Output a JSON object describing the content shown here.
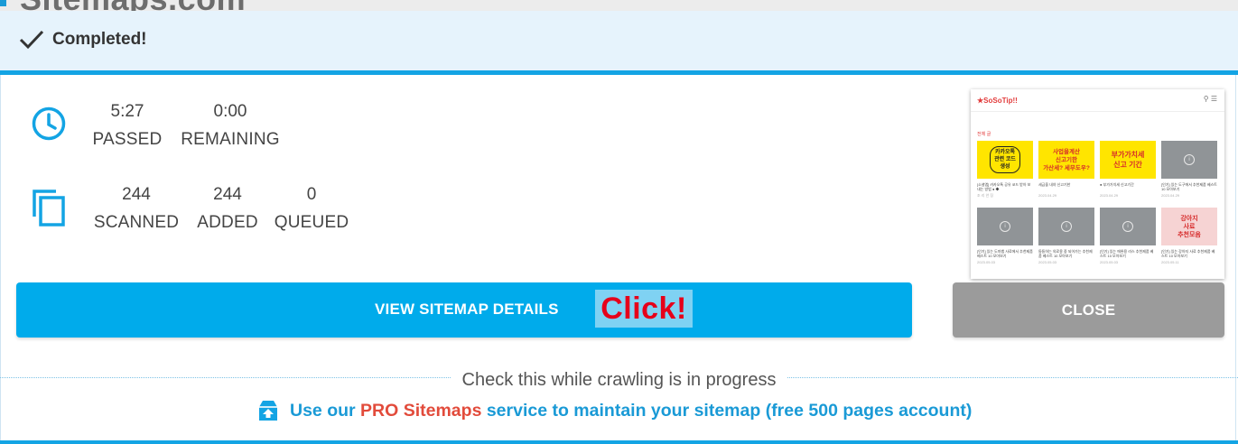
{
  "background_logo": "Sitemaps.com",
  "header": {
    "title": "Completed!",
    "icon": "checkmark-icon"
  },
  "time_stats": [
    {
      "value": "5:27",
      "label": "PASSED"
    },
    {
      "value": "0:00",
      "label": "REMAINING"
    }
  ],
  "page_stats": [
    {
      "value": "244",
      "label": "SCANNED"
    },
    {
      "value": "244",
      "label": "ADDED"
    },
    {
      "value": "0",
      "label": "QUEUED"
    }
  ],
  "icons": {
    "time": "clock-icon",
    "pages": "copy-pages-icon",
    "promo": "upload-cloud-icon"
  },
  "preview": {
    "site_name": "★SoSoTip!!",
    "section": "전체 글",
    "cards": [
      {
        "caption": "[소셜앱] 카카오톡 공유 코드 받아 보내는 방법 ● ◆",
        "date": "조 리 안 징",
        "img_text": "카카오톡\n관련 코드\n생성"
      },
      {
        "caption": "세금을 내야 신고기한",
        "date": "2023.04.29",
        "img_text": "사업을계산\n신고기한\n가산세? 세무도우?"
      },
      {
        "caption": "● 부가가치세 신고기간",
        "date": "2023.04.29",
        "img_text": "부가가치세\n신고 기간"
      },
      {
        "caption": "[인기] 있는 도구에서 추천제품 베스트 10 모아보기",
        "date": "2023.04.29",
        "img_text": ""
      },
      {
        "caption": "[인기] 있는 도마뱀 사료에서 추천제품 베스트 10 모아보기",
        "date": "2023.05.03",
        "img_text": ""
      },
      {
        "caption": "둥둥하는 의료용 중 되어가는 추천제품 베스트 10 모아보기",
        "date": "2023.05.03",
        "img_text": ""
      },
      {
        "caption": "[인기] 있는 애완용 라스 추천제품 베스트 10 모아보기",
        "date": "2023.05.03",
        "img_text": ""
      },
      {
        "caption": "[인기] 있는 강아지 사료 추천제품 베스트 10 모아보기",
        "date": "2023.05.11",
        "img_text": "강아지\n사료\n추천모음"
      }
    ]
  },
  "buttons": {
    "view": "VIEW SITEMAP DETAILS",
    "close": "CLOSE"
  },
  "annotation": "Click!",
  "note": "Check this while crawling is in progress",
  "promo": {
    "part1": "Use our ",
    "part2": "PRO Sitemaps",
    "part3": " service to maintain your sitemap (free 500 pages account)"
  },
  "colors": {
    "accent": "#13a4e4",
    "primary_button": "#00abeb",
    "secondary_button": "#9b9b9b",
    "promo_highlight": "#e24b3b",
    "annotation_text": "#e6001a"
  }
}
